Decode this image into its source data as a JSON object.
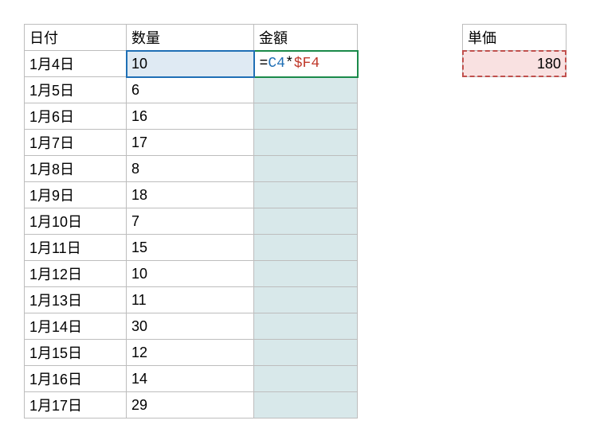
{
  "headers": {
    "date": "日付",
    "qty": "数量",
    "amount": "金額",
    "unit_price": "単価"
  },
  "rows": [
    {
      "date": "1月4日",
      "qty": "10"
    },
    {
      "date": "1月5日",
      "qty": "6"
    },
    {
      "date": "1月6日",
      "qty": "16"
    },
    {
      "date": "1月7日",
      "qty": "17"
    },
    {
      "date": "1月8日",
      "qty": "8"
    },
    {
      "date": "1月9日",
      "qty": "18"
    },
    {
      "date": "1月10日",
      "qty": "7"
    },
    {
      "date": "1月11日",
      "qty": "15"
    },
    {
      "date": "1月12日",
      "qty": "10"
    },
    {
      "date": "1月13日",
      "qty": "11"
    },
    {
      "date": "1月14日",
      "qty": "30"
    },
    {
      "date": "1月15日",
      "qty": "12"
    },
    {
      "date": "1月16日",
      "qty": "14"
    },
    {
      "date": "1月17日",
      "qty": "29"
    }
  ],
  "formula": {
    "eq": "=",
    "ref1": "C4",
    "op": "*",
    "ref2": "$F4"
  },
  "unit_price_value": "180"
}
